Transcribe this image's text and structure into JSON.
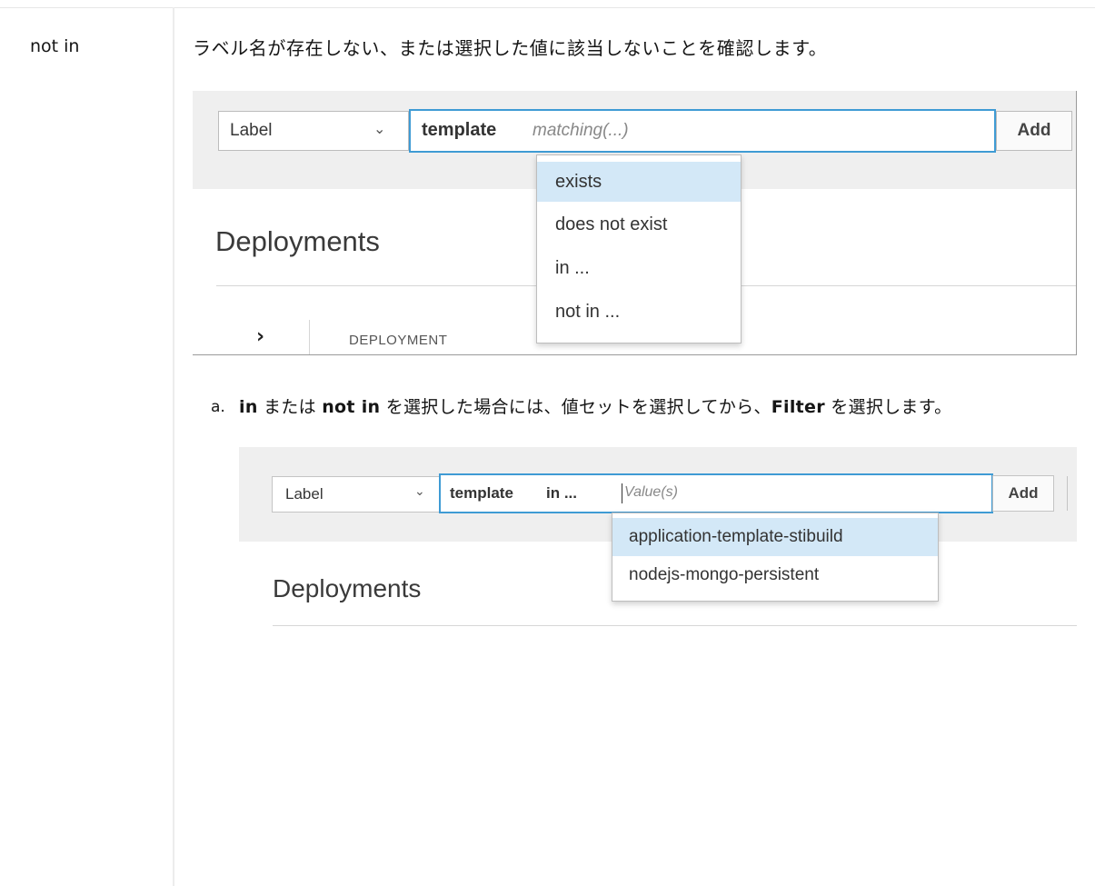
{
  "row": {
    "term": "not in",
    "description": "ラベル名が存在しない、または選択した値に該当しないことを確認します。"
  },
  "screenshot1": {
    "select_label": "Label",
    "select_chevron": "⌄",
    "input_key": "template",
    "input_hint": "matching(...)",
    "add_label": "Add",
    "heading": "Deployments",
    "expand_icon": "›",
    "column_header": "DEPLOYMENT",
    "menu_items": [
      "exists",
      "does not exist",
      "in ...",
      "not in ..."
    ],
    "active_item": "exists"
  },
  "step": {
    "marker": "a.",
    "in_word": "in",
    "part1": " または ",
    "not_in_word": "not in",
    "part2": " を選択した場合には、値セットを選択してから、",
    "filter_word": "Filter",
    "part3": " を選択します。"
  },
  "screenshot2": {
    "select_label": "Label",
    "select_chevron": "⌄",
    "input_key": "template",
    "input_operator": "in ...",
    "input_hint": "Value(s)",
    "add_label": "Add",
    "heading": "Deployments",
    "menu_items": [
      "application-template-stibuild",
      "nodejs-mongo-persistent"
    ],
    "active_item": "application-template-stibuild"
  },
  "colors": {
    "focus_border": "#3f9bd4",
    "menu_active": "#d3e8f7",
    "toolbar_band": "#efefef"
  }
}
